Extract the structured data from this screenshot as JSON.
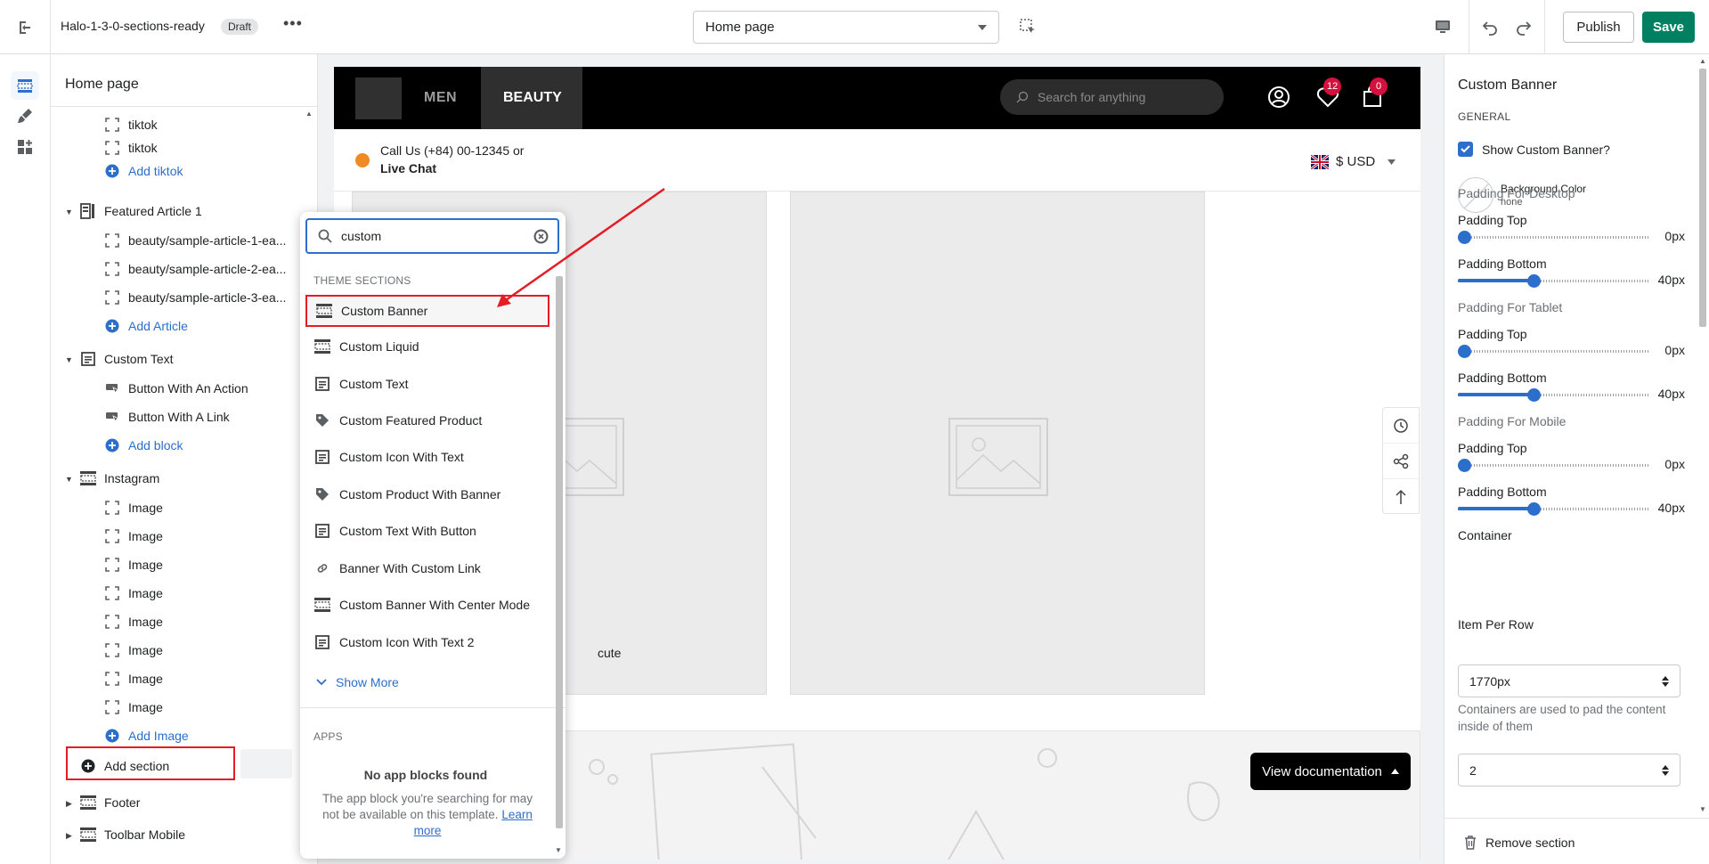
{
  "topbar": {
    "store_name": "Halo-1-3-0-sections-ready",
    "status_badge": "Draft",
    "more_label": "•••",
    "page_select": "Home page",
    "publish_label": "Publish",
    "save_label": "Save"
  },
  "sidebar": {
    "title": "Home page",
    "items": [
      {
        "label": "tiktok",
        "icon": "block-icon"
      },
      {
        "label": "tiktok",
        "icon": "block-icon"
      },
      {
        "label": "Add tiktok",
        "icon": "plus-circle-icon"
      },
      {
        "label": "Featured Article 1",
        "icon": "article-section-icon"
      },
      {
        "label": "beauty/sample-article-1-ea...",
        "icon": "block-icon"
      },
      {
        "label": "beauty/sample-article-2-ea...",
        "icon": "block-icon"
      },
      {
        "label": "beauty/sample-article-3-ea...",
        "icon": "block-icon"
      },
      {
        "label": "Add Article",
        "icon": "plus-circle-icon"
      },
      {
        "label": "Custom Text",
        "icon": "text-section-icon"
      },
      {
        "label": "Button With An Action",
        "icon": "button-block-icon"
      },
      {
        "label": "Button With A Link",
        "icon": "button-block-icon"
      },
      {
        "label": "Add block",
        "icon": "plus-circle-icon"
      },
      {
        "label": "Instagram",
        "icon": "banner-section-icon"
      },
      {
        "label": "Image",
        "icon": "block-icon"
      },
      {
        "label": "Image",
        "icon": "block-icon"
      },
      {
        "label": "Image",
        "icon": "block-icon"
      },
      {
        "label": "Image",
        "icon": "block-icon"
      },
      {
        "label": "Image",
        "icon": "block-icon"
      },
      {
        "label": "Image",
        "icon": "block-icon"
      },
      {
        "label": "Image",
        "icon": "block-icon"
      },
      {
        "label": "Image",
        "icon": "block-icon"
      },
      {
        "label": "Add Image",
        "icon": "plus-circle-icon"
      },
      {
        "label": "Add section",
        "icon": "plus-circle-filled-icon"
      },
      {
        "label": "Footer",
        "icon": "banner-section-icon"
      },
      {
        "label": "Toolbar Mobile",
        "icon": "banner-section-icon"
      }
    ]
  },
  "picker": {
    "search_value": "custom",
    "theme_heading": "THEME SECTIONS",
    "items": [
      {
        "label": "Custom Banner",
        "icon": "banner-section-icon"
      },
      {
        "label": "Custom Liquid",
        "icon": "banner-section-icon"
      },
      {
        "label": "Custom Text",
        "icon": "text-section-icon"
      },
      {
        "label": "Custom Featured Product",
        "icon": "tag-icon"
      },
      {
        "label": "Custom Icon With Text",
        "icon": "text-section-icon"
      },
      {
        "label": "Custom Product With Banner",
        "icon": "tag-icon"
      },
      {
        "label": "Custom Text With Button",
        "icon": "text-section-icon"
      },
      {
        "label": "Banner With Custom Link",
        "icon": "link-icon"
      },
      {
        "label": "Custom Banner With Center Mode",
        "icon": "banner-section-icon"
      },
      {
        "label": "Custom Icon With Text 2",
        "icon": "text-section-icon"
      }
    ],
    "show_more": "Show More",
    "apps_heading": "APPS",
    "empty_title": "No app blocks found",
    "empty_body": "The app block you're searching for may not be available on this template.",
    "learn_more": "Learn more"
  },
  "preview": {
    "nav": [
      "MEN",
      "BEAUTY"
    ],
    "search_placeholder": "Search for anything",
    "wishlist_count": "12",
    "cart_count": "0",
    "contact_line1": "Call Us (+84) 00-12345 or",
    "contact_line2": "Live Chat",
    "currency": "$ USD",
    "banner_caption": "cute",
    "view_doc": "View documentation"
  },
  "settings": {
    "title": "Custom Banner",
    "general": "GENERAL",
    "show_label": "Show Custom Banner?",
    "show_checked": true,
    "bg_color_label": "Background Color",
    "bg_color_value": "none",
    "desktop_group": "Padding For Desktop",
    "tablet_group": "Padding For Tablet",
    "mobile_group": "Padding For Mobile",
    "padding_top": "Padding Top",
    "padding_bottom": "Padding Bottom",
    "desktop_top": "0px",
    "desktop_bottom": "40px",
    "tablet_top": "0px",
    "tablet_bottom": "40px",
    "mobile_top": "0px",
    "mobile_bottom": "40px",
    "container_label": "Container",
    "container_value": "1770px",
    "container_help": "Containers are used to pad the content inside of them",
    "item_per_row_label": "Item Per Row",
    "item_per_row_value": "2",
    "remove_section": "Remove section"
  },
  "colors": {
    "accent": "#2c6ecb",
    "save": "#008060",
    "highlight": "#e51c23"
  }
}
